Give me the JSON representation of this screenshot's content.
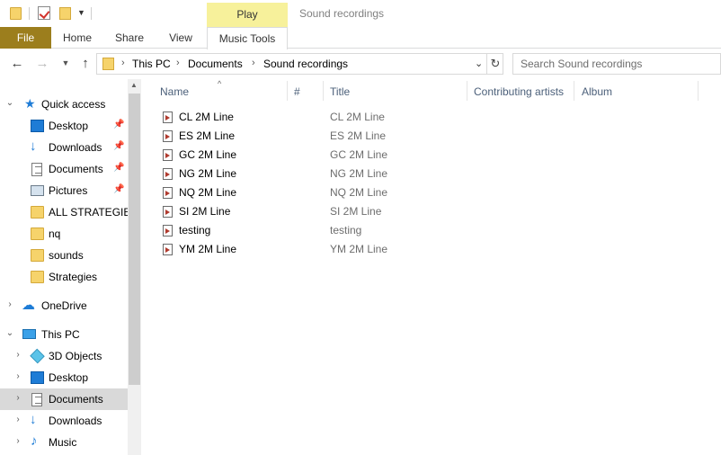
{
  "window": {
    "title": "Sound recordings",
    "contextual_tab_group": "Play"
  },
  "ribbon": {
    "tabs": [
      {
        "label": "File"
      },
      {
        "label": "Home"
      },
      {
        "label": "Share"
      },
      {
        "label": "View"
      },
      {
        "label": "Music Tools"
      }
    ]
  },
  "address": {
    "crumbs": [
      "This PC",
      "Documents",
      "Sound recordings"
    ]
  },
  "search": {
    "placeholder": "Search Sound recordings"
  },
  "sidebar": {
    "items": [
      {
        "label": "Quick access",
        "icon": "star-icon",
        "pinned": false
      },
      {
        "label": "Desktop",
        "icon": "desktop-icon",
        "pinned": true
      },
      {
        "label": "Downloads",
        "icon": "download-icon",
        "pinned": true
      },
      {
        "label": "Documents",
        "icon": "document-icon",
        "pinned": true
      },
      {
        "label": "Pictures",
        "icon": "pictures-icon",
        "pinned": true
      },
      {
        "label": "ALL STRATEGIES",
        "icon": "folder-icon",
        "pinned": false
      },
      {
        "label": "nq",
        "icon": "folder-icon",
        "pinned": false
      },
      {
        "label": "sounds",
        "icon": "folder-icon",
        "pinned": false
      },
      {
        "label": "Strategies",
        "icon": "folder-icon",
        "pinned": false
      },
      {
        "label": "OneDrive",
        "icon": "cloud-icon",
        "pinned": false
      },
      {
        "label": "This PC",
        "icon": "computer-icon",
        "pinned": false
      },
      {
        "label": "3D Objects",
        "icon": "cube-icon",
        "pinned": false
      },
      {
        "label": "Desktop",
        "icon": "desktop-icon",
        "pinned": false
      },
      {
        "label": "Documents",
        "icon": "document-icon",
        "pinned": false,
        "selected": true
      },
      {
        "label": "Downloads",
        "icon": "download-icon",
        "pinned": false
      },
      {
        "label": "Music",
        "icon": "music-icon",
        "pinned": false
      }
    ]
  },
  "columns": {
    "name": "Name",
    "number": "#",
    "title": "Title",
    "artists": "Contributing artists",
    "album": "Album"
  },
  "files": [
    {
      "name": "CL 2M Line",
      "title": "CL 2M Line"
    },
    {
      "name": "ES 2M Line",
      "title": "ES 2M Line"
    },
    {
      "name": "GC 2M Line",
      "title": "GC 2M Line"
    },
    {
      "name": "NG 2M Line",
      "title": "NG 2M Line"
    },
    {
      "name": "NQ 2M Line",
      "title": "NQ 2M Line"
    },
    {
      "name": "SI 2M Line",
      "title": "SI 2M Line"
    },
    {
      "name": "testing",
      "title": "testing"
    },
    {
      "name": "YM 2M Line",
      "title": "YM 2M Line"
    }
  ],
  "colors": {
    "file_tab": "#9c7e1d",
    "play_tab": "#f7f19b",
    "selected_nav": "#d9d9d9",
    "column_header": "#4c607a"
  }
}
